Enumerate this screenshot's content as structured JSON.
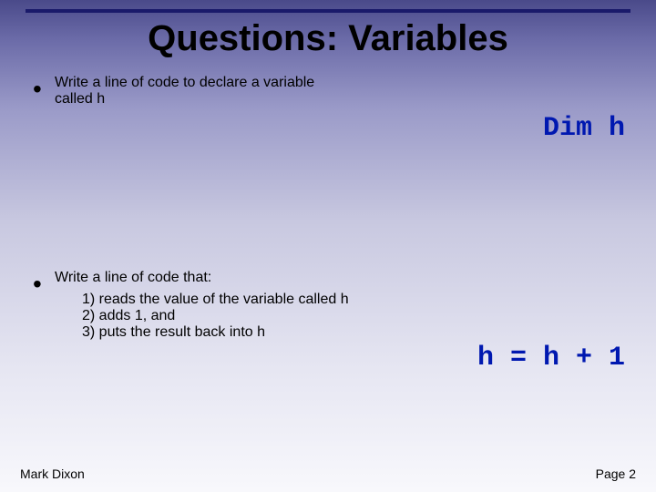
{
  "title": "Questions: Variables",
  "block1": {
    "line1": "Write a line of code to declare a variable",
    "line2": "called h",
    "answer": "Dim h"
  },
  "block2": {
    "intro": "Write a line of code that:",
    "step1": "1) reads the value of the variable called h",
    "step2": "2) adds 1, and",
    "step3": "3) puts the result back into h",
    "answer": "h = h + 1"
  },
  "footer": {
    "author": "Mark Dixon",
    "page": "Page 2"
  }
}
